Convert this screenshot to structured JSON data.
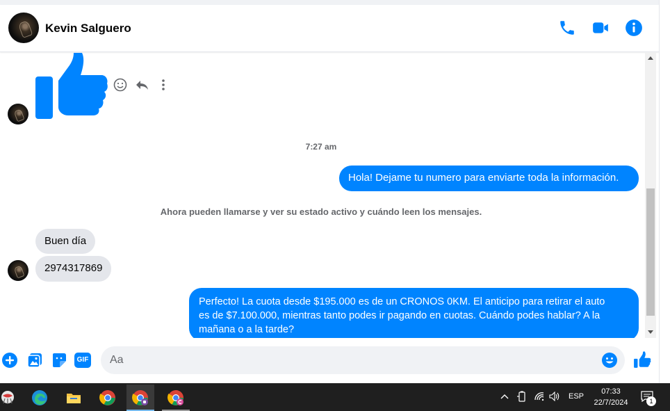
{
  "header": {
    "contact_name": "Kevin Salguero",
    "icons": [
      "phone-icon",
      "video-camera-icon",
      "info-icon"
    ]
  },
  "conversation": {
    "reaction_icons": [
      "emoji-icon",
      "reply-icon",
      "more-icon"
    ],
    "timestamp": "7:27 am",
    "outgoing_1": "Hola! Dejame tu numero  para enviarte toda la información.",
    "system_note": "Ahora pueden llamarse y ver su estado activo y cuándo leen los mensajes.",
    "incoming_1": "Buen día",
    "incoming_2": "2974317869",
    "outgoing_2_line1": "Perfecto! La cuota desde $195.000 es de un CRONOS 0KM. El anticipo para retirar el auto",
    "outgoing_2_line2": "es de $7.100.000, mientras tanto podes ir pagando en cuotas. Cuándo podes hablar? A la",
    "outgoing_2_line3": "mañana o a la tarde?"
  },
  "composer": {
    "placeholder": "Aa",
    "icons": [
      "plus-icon",
      "image-icon",
      "sticker-icon",
      "gif-icon",
      "emoji-icon",
      "like-icon"
    ],
    "gif_label": "GIF"
  },
  "taskbar": {
    "apps": [
      "start-icon",
      "edge-icon",
      "file-explorer-icon",
      "chrome-icon",
      "chrome-profile-icon",
      "chrome-profile-c-icon"
    ],
    "language": "ESP",
    "time": "07:33",
    "date": "22/7/2024",
    "notification_count": "1"
  },
  "colors": {
    "messenger_blue": "#0084ff",
    "incoming_bubble": "#e4e6eb",
    "taskbar": "#1f1f1f"
  }
}
